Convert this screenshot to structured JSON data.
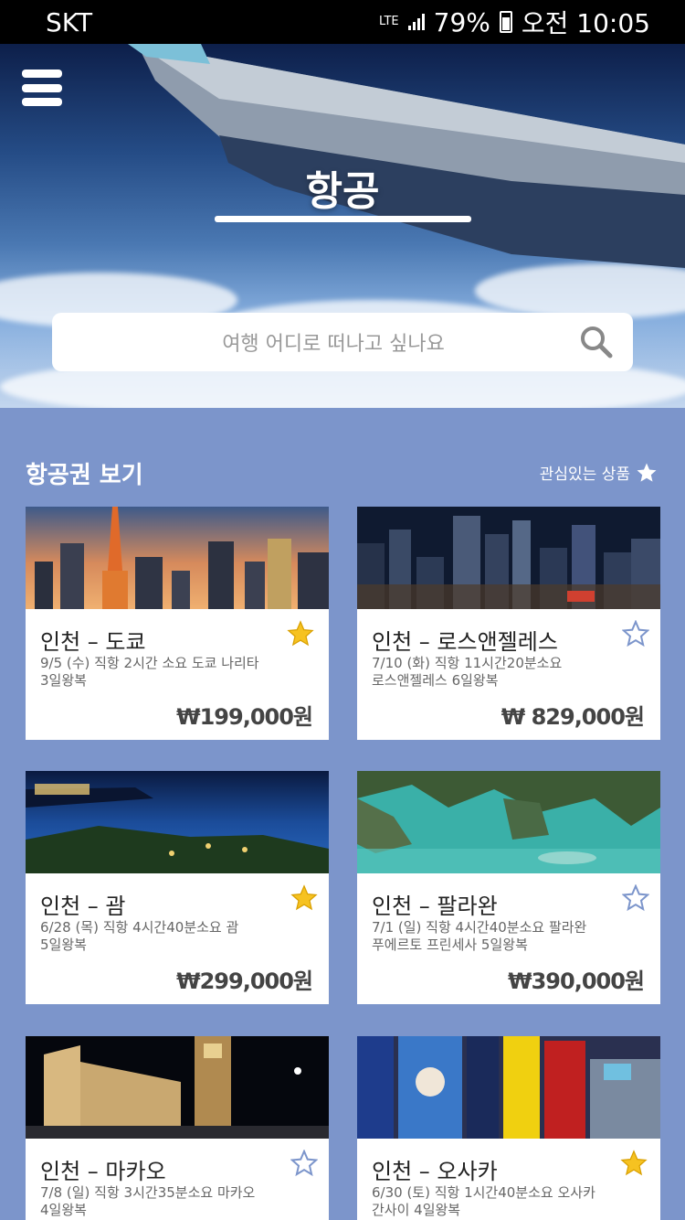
{
  "status_bar": {
    "carrier": "SKT",
    "network": "LTE",
    "battery": "79%",
    "time": "오전 10:05"
  },
  "hero": {
    "title": "항공",
    "search_placeholder": "여행 어디로 떠나고 싶나요"
  },
  "section": {
    "title": "항공권 보기",
    "favorites_label": "관심있는 상품"
  },
  "colors": {
    "background": "#7c95cb",
    "star_filled": "#f6c221",
    "star_outline": "#7c95cb"
  },
  "cards": [
    {
      "title": "인천 – 도쿄",
      "desc_1": "9/5 (수) 직항 2시간 소요 도쿄 나리타",
      "desc_2": "3일왕복",
      "price": "₩199,000원",
      "favorite": true,
      "image": "tokyo-tower-skyline"
    },
    {
      "title": "인천 – 로스앤젤레스",
      "desc_1": "7/10 (화) 직항 11시간20분소요",
      "desc_2": "로스앤젤레스 6일왕복",
      "price": "₩ 829,000원",
      "favorite": false,
      "image": "los-angeles-night-skyline"
    },
    {
      "title": "인천 – 괌",
      "desc_1": "6/28 (목) 직항 4시간40분소요 괌",
      "desc_2": "5일왕복",
      "price": "₩299,000원",
      "favorite": true,
      "image": "guam-bay-night"
    },
    {
      "title": "인천 – 팔라완",
      "desc_1": "7/1 (일) 직항 4시간40분소요 팔라완",
      "desc_2": "푸에르토 프린세사 5일왕복",
      "price": "₩390,000원",
      "favorite": false,
      "image": "palawan-lagoon"
    },
    {
      "title": "인천 – 마카오",
      "desc_1": "7/8 (일) 직항 3시간35분소요 마카오",
      "desc_2": "4일왕복",
      "price": "",
      "favorite": false,
      "image": "macau-hotel-night"
    },
    {
      "title": "인천 – 오사카",
      "desc_1": "6/30 (토) 직항 1시간40분소요 오사카",
      "desc_2": "간사이 4일왕복",
      "price": "",
      "favorite": true,
      "image": "osaka-dotonbori-signs"
    }
  ]
}
